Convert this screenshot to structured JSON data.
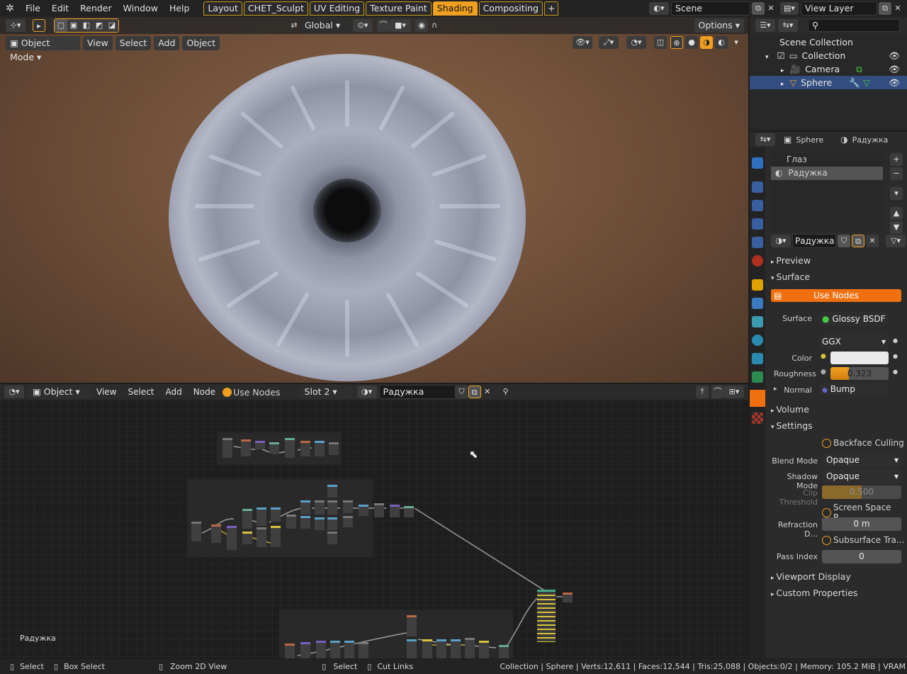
{
  "topbar": {
    "menus": [
      "File",
      "Edit",
      "Render",
      "Window",
      "Help"
    ],
    "workspaces": [
      {
        "label": "Layout",
        "active": false
      },
      {
        "label": "CHET_Sculpt",
        "active": false
      },
      {
        "label": "UV Editing",
        "active": false
      },
      {
        "label": "Texture Paint",
        "active": false
      },
      {
        "label": "Shading",
        "active": true
      },
      {
        "label": "Compositing",
        "active": false
      }
    ],
    "add_tab": "+",
    "scene": "Scene",
    "view_layer": "View Layer"
  },
  "viewport": {
    "transform_orientation": "Global",
    "options_label": "Options",
    "mode": "Object Mode",
    "menus": [
      "View",
      "Select",
      "Add",
      "Object"
    ]
  },
  "node_editor": {
    "editor_type": "Object",
    "menus": [
      "View",
      "Select",
      "Add",
      "Node"
    ],
    "use_nodes_label": "Use Nodes",
    "slot": "Slot 2",
    "material": "Радужка",
    "corner_label": "Радужка"
  },
  "outliner": {
    "rows": [
      {
        "label": "Scene Collection"
      },
      {
        "label": "Collection"
      },
      {
        "label": "Camera"
      },
      {
        "label": "Sphere"
      }
    ]
  },
  "properties": {
    "breadcrumb_object": "Sphere",
    "breadcrumb_material": "Радужка",
    "slots": [
      "Глаз",
      "Радужка"
    ],
    "material_name": "Радужка",
    "sections": {
      "preview": "Preview",
      "surface": "Surface",
      "volume": "Volume",
      "settings": "Settings",
      "viewport_display": "Viewport Display",
      "custom_properties": "Custom Properties"
    },
    "use_nodes_button": "Use Nodes",
    "surface_label": "Surface",
    "surface_value": "Glossy BSDF",
    "distribution": "GGX",
    "color_label": "Color",
    "roughness_label": "Roughness",
    "roughness_value": "0.323",
    "roughness_fraction": 0.323,
    "normal_label": "Normal",
    "normal_value": "Bump",
    "backface_culling": "Backface Culling",
    "blend_mode_label": "Blend Mode",
    "blend_mode": "Opaque",
    "shadow_mode_label": "Shadow Mode",
    "shadow_mode": "Opaque",
    "clip_threshold_label": "Clip Threshold",
    "clip_threshold": "0.500",
    "clip_threshold_fraction": 0.5,
    "screen_space_refraction": "Screen Space R...",
    "refraction_depth_label": "Refraction D...",
    "refraction_depth": "0 m",
    "subsurface_translucency": "Subsurface Tra...",
    "pass_index_label": "Pass Index",
    "pass_index": "0"
  },
  "statusbar": {
    "select": "Select",
    "box_select": "Box Select",
    "zoom": "Zoom 2D View",
    "select2": "Select",
    "cut_links": "Cut Links",
    "stats": "Collection | Sphere | Verts:12,611 | Faces:12,544 | Tris:25,088 | Objects:0/2 | Memory: 105.2 MiB | VRAM"
  },
  "colors": {
    "accent": "#f0a020",
    "selection": "#334d80",
    "background": "#1d1d1d"
  }
}
